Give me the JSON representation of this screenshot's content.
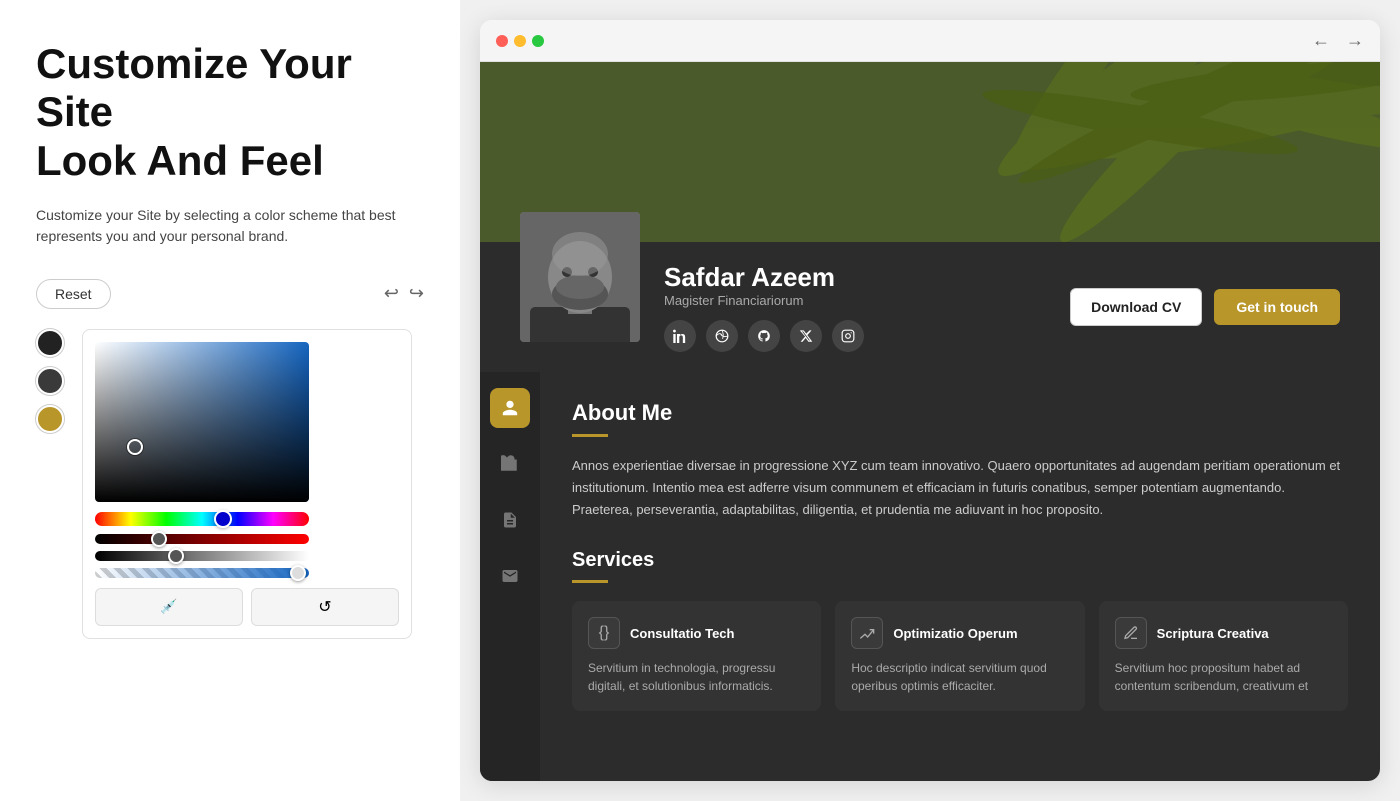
{
  "left": {
    "heading_line1": "Customize Your Site",
    "heading_line2": "Look And Feel",
    "subtitle": "Customize your Site by selecting a color scheme that best represents you and your personal brand.",
    "reset_label": "Reset",
    "undo_icon": "↩",
    "redo_icon": "↪",
    "swatches": [
      {
        "color": "#222222",
        "label": "black"
      },
      {
        "color": "#3a3a3a",
        "label": "dark-gray"
      },
      {
        "color": "#b8962a",
        "label": "gold"
      }
    ],
    "eyedropper_icon": "🔍",
    "reset_color_icon": "↺"
  },
  "browser": {
    "dot_colors": [
      "#ff5f57",
      "#febc2e",
      "#28c840"
    ],
    "back_icon": "←",
    "forward_icon": "→"
  },
  "profile": {
    "name": "Safdar Azeem",
    "title": "Magister Financiariorum",
    "social_icons": [
      "in",
      "🎯",
      "⌥",
      "𝕏",
      "◎"
    ],
    "btn_cv": "Download CV",
    "btn_contact": "Get in touch"
  },
  "about": {
    "section_title": "About Me",
    "text": "Annos experientiae diversae in progressione XYZ cum team innovativo. Quaero opportunitates ad augendam peritiam operationum et institutionum. Intentio mea est adferre visum communem et efficaciam in futuris conatibus, semper potentiam augmentando. Praeterea, perseverantia, adaptabilitas, diligentia, et prudentia me adiuvant in hoc proposito."
  },
  "services": {
    "section_title": "Services",
    "cards": [
      {
        "icon": "{}",
        "name": "Consultatio Tech",
        "desc": "Servitium in technologia, progressu digitali, et solutionibus informaticis."
      },
      {
        "icon": "↗",
        "name": "Optimizatio Operum",
        "desc": "Hoc descriptio indicat servitium quod operibus optimis efficaciter."
      },
      {
        "icon": "✏",
        "name": "Scriptura Creativa",
        "desc": "Servitium hoc propositum habet ad contentum scribendum, creativum et"
      }
    ]
  },
  "nav_items": [
    {
      "icon": "👤",
      "active": true
    },
    {
      "icon": "📁",
      "active": false
    },
    {
      "icon": "📋",
      "active": false
    },
    {
      "icon": "🪪",
      "active": false
    }
  ]
}
